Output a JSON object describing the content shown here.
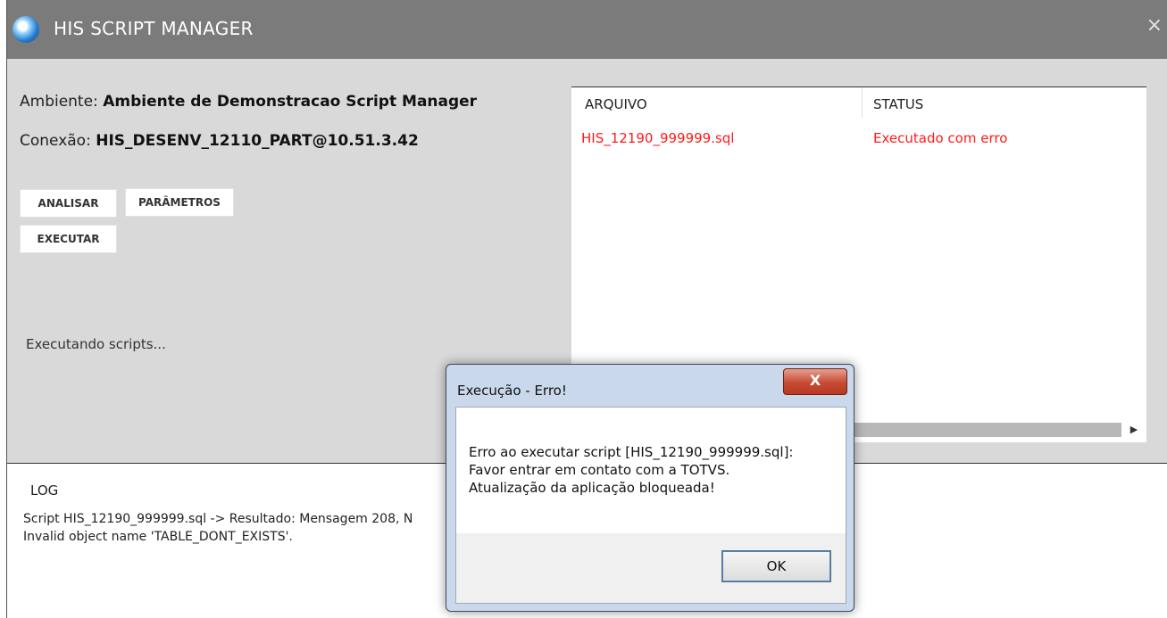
{
  "window": {
    "title": "HIS SCRIPT MANAGER",
    "close_glyph": "×"
  },
  "info": {
    "ambiente_label": "Ambiente:",
    "ambiente_value": "Ambiente de Demonstracao Script Manager",
    "conexao_label": "Conexão:",
    "conexao_value": "HIS_DESENV_12110_PART@10.51.3.42"
  },
  "buttons": {
    "analisar": "ANALISAR",
    "parametros": "PARÂMETROS",
    "executar": "EXECUTAR"
  },
  "status_text": "Executando scripts...",
  "grid": {
    "columns": [
      "ARQUIVO",
      "STATUS"
    ],
    "rows": [
      {
        "arquivo": "HIS_12190_999999.sql",
        "status": "Executado com erro"
      }
    ],
    "error_color": "#ff1a1a"
  },
  "log": {
    "title": "LOG",
    "lines": [
      "Script HIS_12190_999999.sql -> Resultado: Mensagem 208, N",
      "Invalid object name 'TABLE_DONT_EXISTS'."
    ]
  },
  "dialog": {
    "title": "Execução - Erro!",
    "close_glyph": "X",
    "message": [
      "Erro ao executar script [HIS_12190_999999.sql]:",
      " Favor entrar em contato com a TOTVS.",
      " Atualização da aplicação bloqueada!"
    ],
    "ok_label": "OK"
  }
}
